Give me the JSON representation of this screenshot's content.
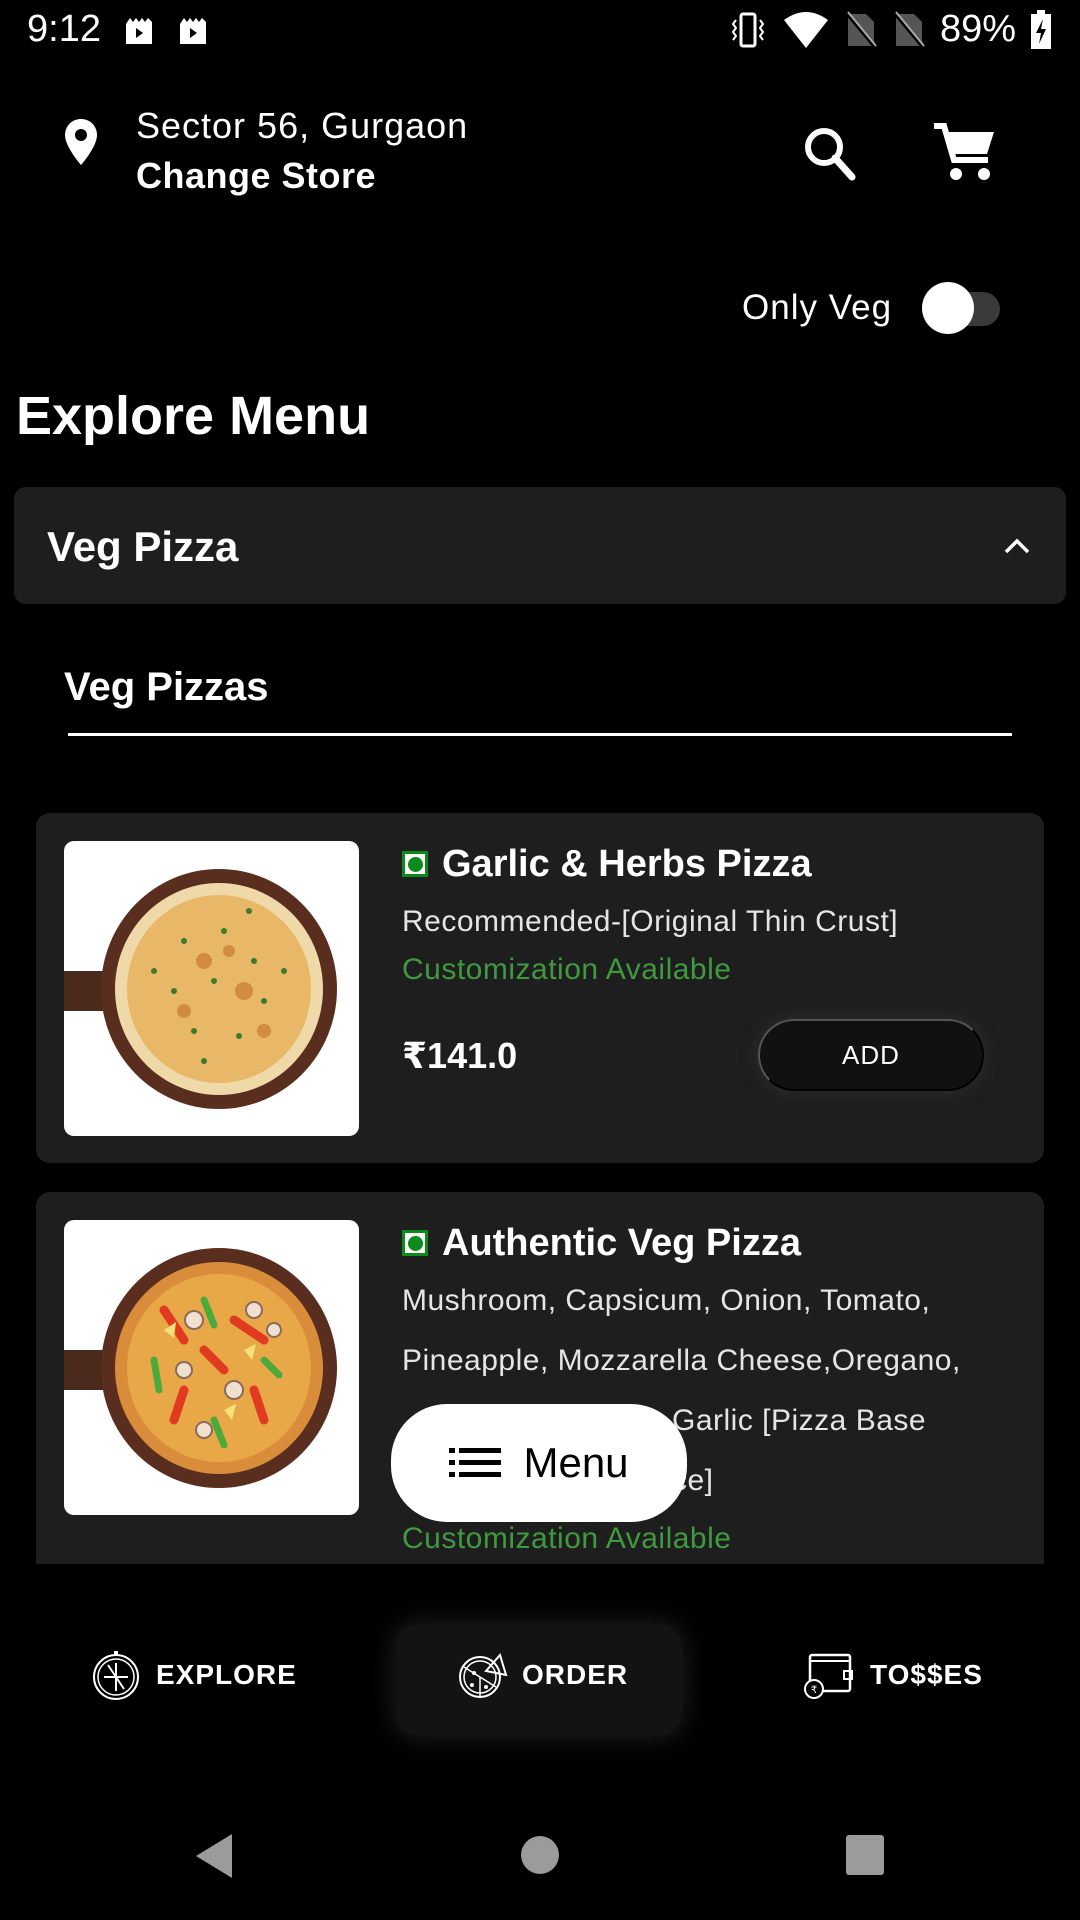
{
  "status_bar": {
    "time": "9:12",
    "battery_percent": "89%",
    "left_icons": [
      "media-icon",
      "media-icon"
    ],
    "right_icons": [
      "vibrate-icon",
      "wifi-icon",
      "no-sim-icon",
      "no-sim-icon",
      "battery-charging-icon"
    ]
  },
  "header": {
    "location": "Sector 56, Gurgaon",
    "change_store_label": "Change Store",
    "icons": [
      "location-pin-icon",
      "search-icon",
      "cart-icon"
    ]
  },
  "filter": {
    "only_veg_label": "Only Veg",
    "only_veg_enabled": false
  },
  "page": {
    "title": "Explore Menu"
  },
  "category": {
    "label": "Veg Pizza",
    "expanded": true
  },
  "subcategory": {
    "label": "Veg Pizzas"
  },
  "products": [
    {
      "name": "Garlic & Herbs Pizza",
      "veg": true,
      "description_lines": [
        "Recommended-[Original Thin Crust]"
      ],
      "customization": "Customization Available",
      "price": "₹141.0",
      "add_label": "ADD"
    },
    {
      "name": "Authentic Veg Pizza",
      "veg": true,
      "description_lines": [
        "Mushroom, Capsicum, Onion, Tomato,",
        "Pineapple, Mozzarella Cheese,Oregano,",
        "Garlic [Pizza Base",
        "ce]"
      ],
      "customization": "Customization Available"
    }
  ],
  "floating_menu": {
    "label": "Menu"
  },
  "bottom_nav": {
    "items": [
      {
        "label": "EXPLORE",
        "icon": "compass-icon",
        "active": false
      },
      {
        "label": "ORDER",
        "icon": "pizza-icon",
        "active": true
      },
      {
        "label": "TO$$ES",
        "icon": "wallet-icon",
        "active": false
      }
    ]
  },
  "colors": {
    "background": "#000000",
    "card": "#1f1e1f",
    "veg_green": "#0d8a1c",
    "customization_green": "#3f9a3f"
  }
}
